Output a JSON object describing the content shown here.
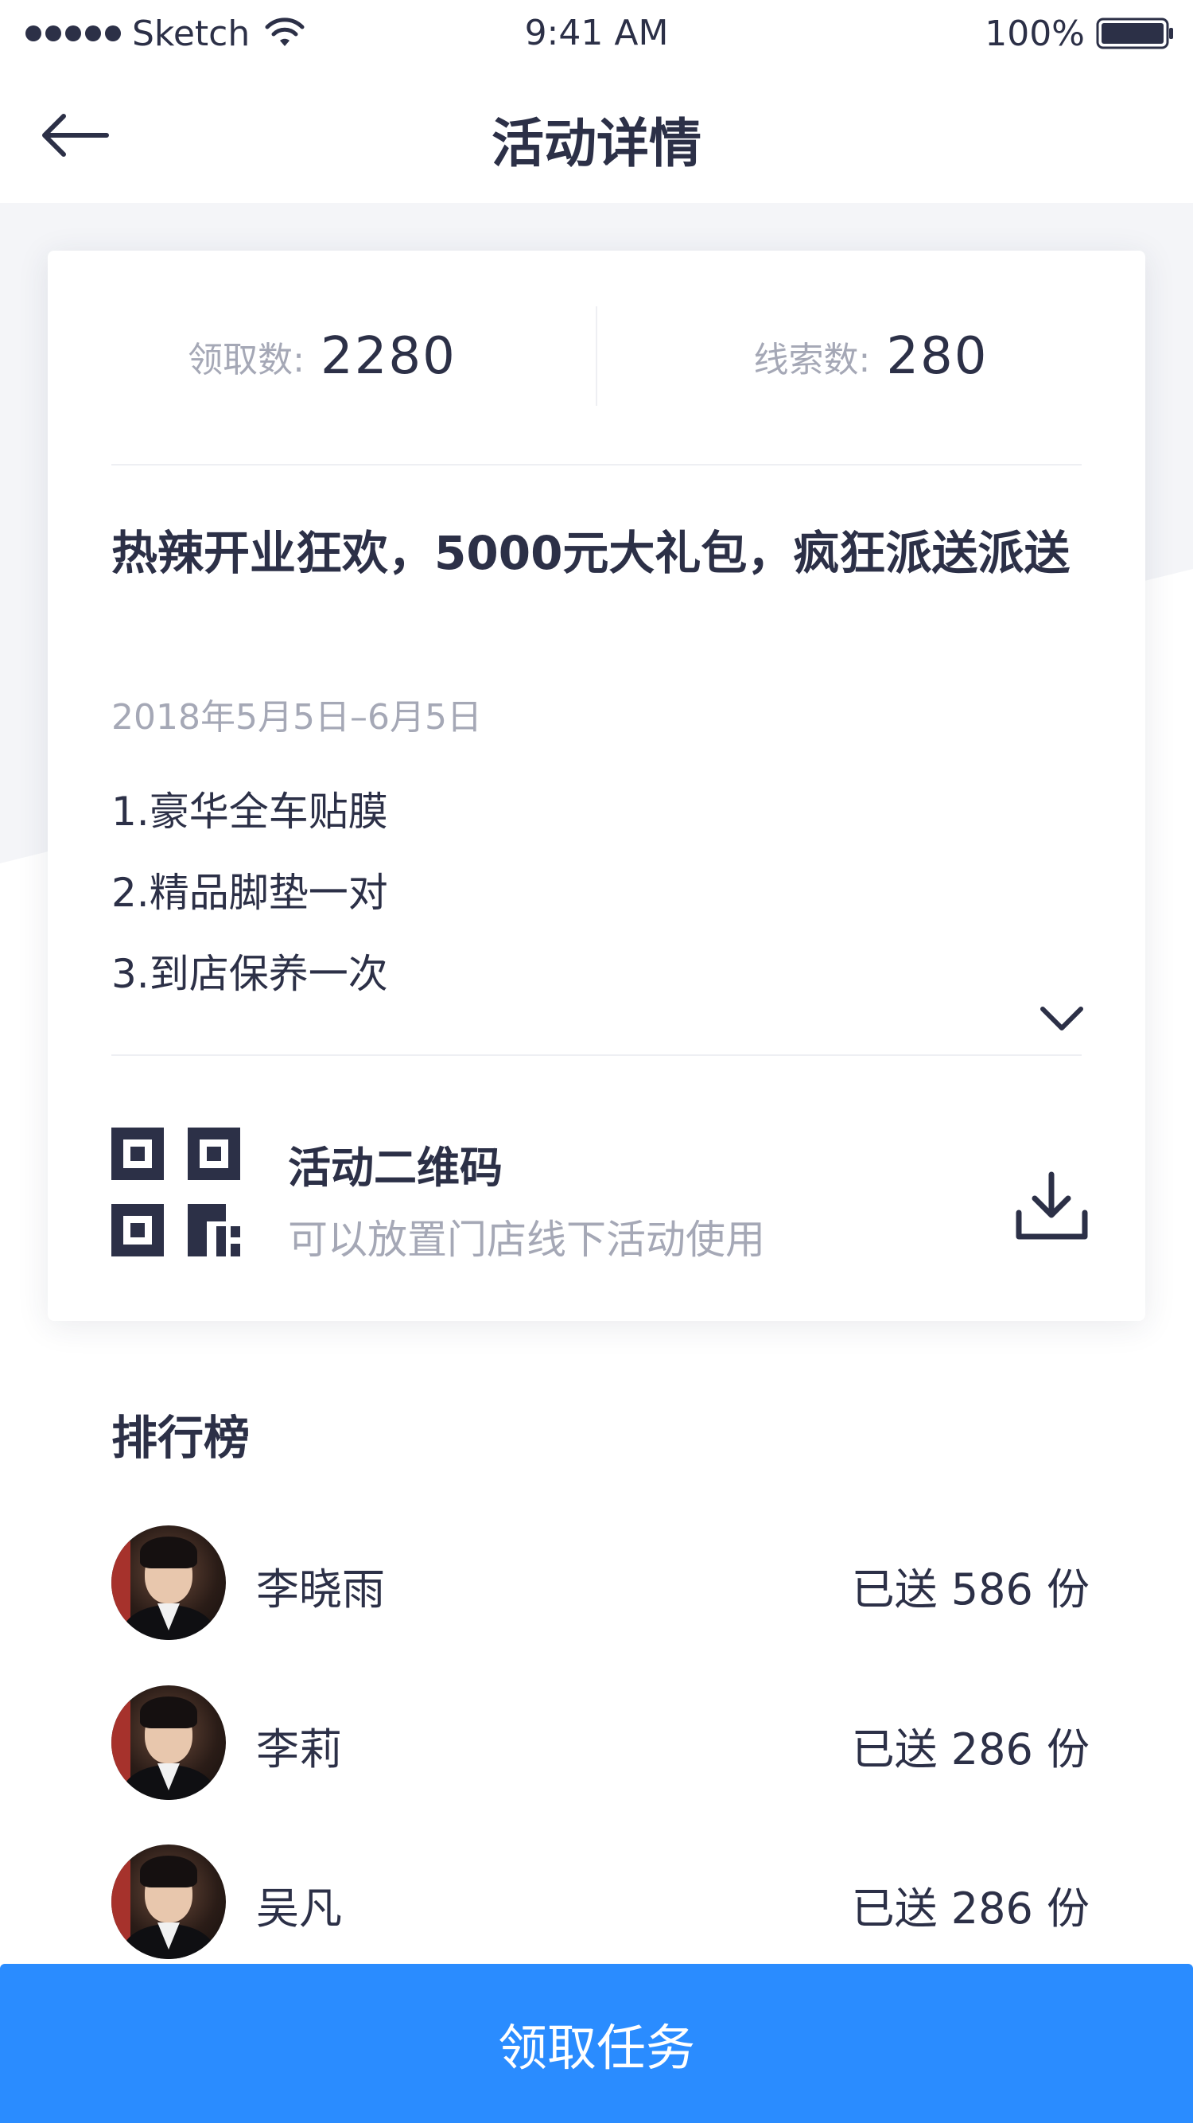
{
  "status_bar": {
    "carrier": "Sketch",
    "time": "9:41 AM",
    "battery": "100%"
  },
  "nav": {
    "title": "活动详情"
  },
  "stats": {
    "claimed_label": "领取数:",
    "claimed_value": "2280",
    "leads_label": "线索数:",
    "leads_value": "280"
  },
  "activity": {
    "title": "热辣开业狂欢，5000元大礼包，疯狂派送派送",
    "date": "2018年5月5日–6月5日",
    "perks": [
      "1.豪华全车贴膜",
      "2.精品脚垫一对",
      "3.到店保养一次"
    ]
  },
  "qr": {
    "title": "活动二维码",
    "description": "可以放置门店线下活动使用"
  },
  "ranking": {
    "title": "排行榜",
    "rows": [
      {
        "name": "李晓雨",
        "count": "已送 586 份"
      },
      {
        "name": "李莉",
        "count": "已送 286 份"
      },
      {
        "name": "吴凡",
        "count": "已送 286 份"
      }
    ]
  },
  "cta": {
    "label": "领取任务"
  },
  "colors": {
    "primary": "#2a8cff",
    "text": "#2c3047",
    "muted": "#a5a8b6"
  }
}
